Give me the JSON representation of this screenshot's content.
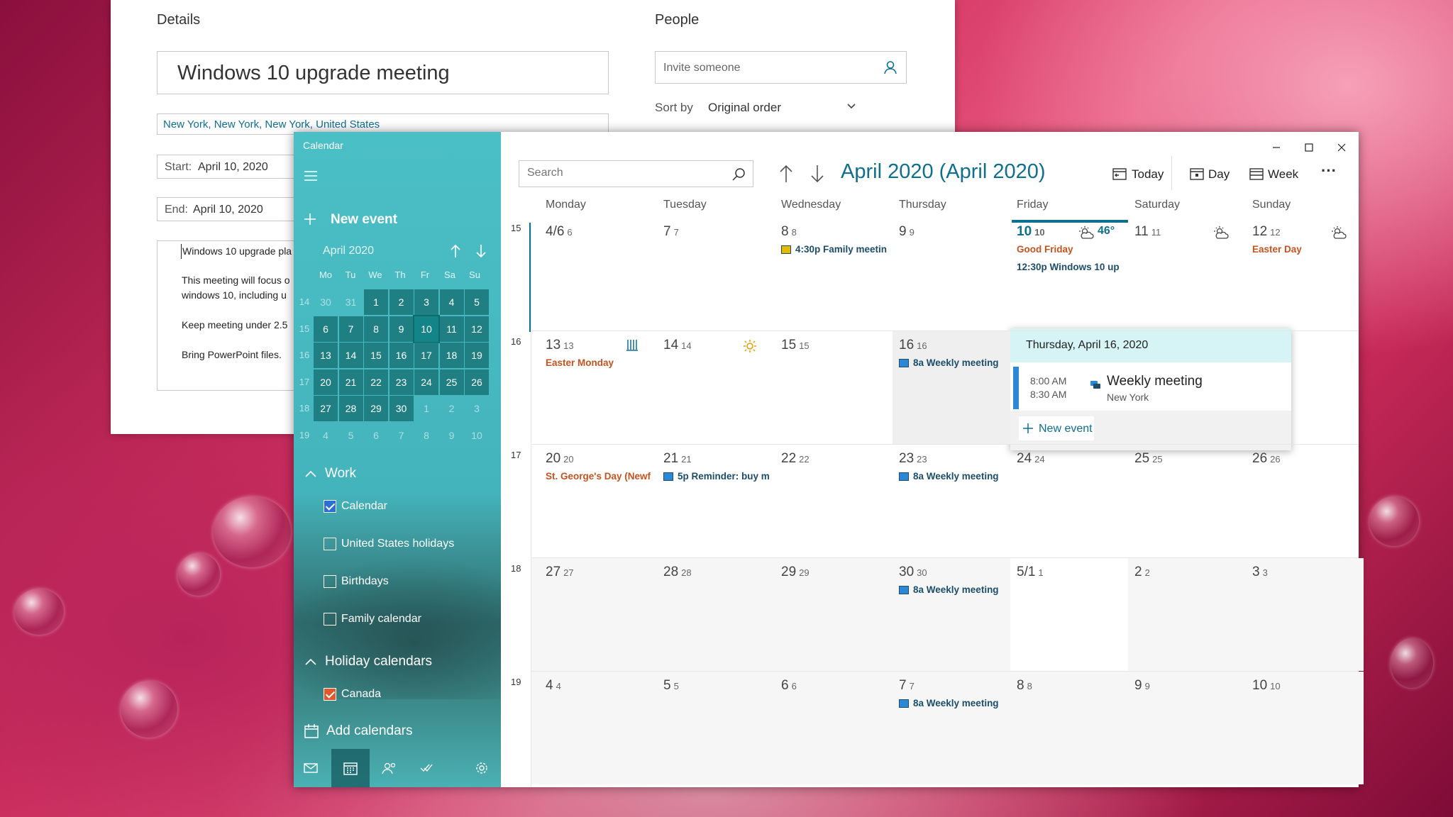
{
  "editor": {
    "details_label": "Details",
    "people_label": "People",
    "title_value": "Windows 10 upgrade meeting",
    "location_value": "New York, New York, New York, United States",
    "start_label": "Start:",
    "start_value": "April 10, 2020",
    "end_label": "End:",
    "end_value": "April 10, 2020",
    "body_lines": [
      "Windows 10 upgrade pla",
      "This meeting will focus o",
      "windows 10, including u",
      "Keep meeting under 2.5",
      "Bring PowerPoint files."
    ],
    "invite_placeholder": "Invite someone",
    "sort_label": "Sort by",
    "sort_value": "Original order"
  },
  "window": {
    "title": "Calendar"
  },
  "sidebar": {
    "new_event": "New event",
    "mini_cal_title": "April 2020",
    "weekday_heads": [
      "Mo",
      "Tu",
      "We",
      "Th",
      "Fr",
      "Sa",
      "Su"
    ],
    "weeks": [
      {
        "wk": "14",
        "days": [
          "30",
          "31",
          "1",
          "2",
          "3",
          "4",
          "5"
        ]
      },
      {
        "wk": "15",
        "days": [
          "6",
          "7",
          "8",
          "9",
          "10",
          "11",
          "12"
        ]
      },
      {
        "wk": "16",
        "days": [
          "13",
          "14",
          "15",
          "16",
          "17",
          "18",
          "19"
        ]
      },
      {
        "wk": "17",
        "days": [
          "20",
          "21",
          "22",
          "23",
          "24",
          "25",
          "26"
        ]
      },
      {
        "wk": "18",
        "days": [
          "27",
          "28",
          "29",
          "30",
          "1",
          "2",
          "3"
        ]
      },
      {
        "wk": "19",
        "days": [
          "4",
          "5",
          "6",
          "7",
          "8",
          "9",
          "10"
        ]
      }
    ],
    "group_work": "Work",
    "work_items": [
      {
        "label": "Calendar",
        "checked": true
      },
      {
        "label": "United States holidays",
        "checked": false
      },
      {
        "label": "Birthdays",
        "checked": false
      },
      {
        "label": "Family calendar",
        "checked": false
      }
    ],
    "group_holiday": "Holiday calendars",
    "holiday_items": [
      {
        "label": "Canada",
        "checked": true
      }
    ],
    "add_calendars": "Add calendars"
  },
  "toolbar": {
    "search_placeholder": "Search",
    "month_title": "April 2020 (April 2020)",
    "today": "Today",
    "day": "Day",
    "week": "Week",
    "more": "···"
  },
  "weekdays": [
    "Monday",
    "Tuesday",
    "Wednesday",
    "Thursday",
    "Friday",
    "Saturday",
    "Sunday"
  ],
  "weeks": [
    {
      "wk": "15",
      "days": [
        {
          "big": "4/6",
          "small": "6"
        },
        {
          "big": "7",
          "small": "7"
        },
        {
          "big": "8",
          "small": "8",
          "event": "4:30p Family meetin"
        },
        {
          "big": "9",
          "small": "9"
        },
        {
          "big": "10",
          "small": "10",
          "temp": "46°",
          "holiday": "Good Friday",
          "event": "12:30p  Windows 10 up"
        },
        {
          "big": "11",
          "small": "11"
        },
        {
          "big": "12",
          "small": "12",
          "holiday": "Easter Day"
        }
      ]
    },
    {
      "wk": "16",
      "days": [
        {
          "big": "13",
          "small": "13",
          "holiday": "Easter Monday"
        },
        {
          "big": "14",
          "small": "14"
        },
        {
          "big": "15",
          "small": "15"
        },
        {
          "big": "16",
          "small": "16",
          "event": "8a Weekly meeting"
        },
        {
          "big": "",
          "small": ""
        },
        {
          "big": "",
          "small": ""
        },
        {
          "big": "",
          "small": ""
        }
      ]
    },
    {
      "wk": "17",
      "days": [
        {
          "big": "20",
          "small": "20",
          "holiday": "St. George's Day (Newf"
        },
        {
          "big": "21",
          "small": "21",
          "event": "5p Reminder: buy m"
        },
        {
          "big": "22",
          "small": "22"
        },
        {
          "big": "23",
          "small": "23",
          "event": "8a Weekly meeting"
        },
        {
          "big": "24",
          "small": "24"
        },
        {
          "big": "25",
          "small": "25"
        },
        {
          "big": "26",
          "small": "26"
        }
      ]
    },
    {
      "wk": "18",
      "days": [
        {
          "big": "27",
          "small": "27"
        },
        {
          "big": "28",
          "small": "28"
        },
        {
          "big": "29",
          "small": "29"
        },
        {
          "big": "30",
          "small": "30",
          "event": "8a Weekly meeting"
        },
        {
          "big": "5/1",
          "small": "1"
        },
        {
          "big": "2",
          "small": "2"
        },
        {
          "big": "3",
          "small": "3"
        }
      ]
    },
    {
      "wk": "19",
      "days": [
        {
          "big": "4",
          "small": "4"
        },
        {
          "big": "5",
          "small": "5"
        },
        {
          "big": "6",
          "small": "6"
        },
        {
          "big": "7",
          "small": "7",
          "event": "8a Weekly meeting"
        },
        {
          "big": "8",
          "small": "8"
        },
        {
          "big": "9",
          "small": "9"
        },
        {
          "big": "10",
          "small": "10"
        }
      ]
    }
  ],
  "popup": {
    "date": "Thursday, April 16, 2020",
    "start": "8:00 AM",
    "end": "8:30 AM",
    "title": "Weekly meeting",
    "location": "New York",
    "new_event": "New event"
  },
  "colors": {
    "accent": "#0f6f8f",
    "sidebar": "#4bbfc6",
    "holiday": "#c6531f",
    "event_bar": "#2b88d8"
  }
}
